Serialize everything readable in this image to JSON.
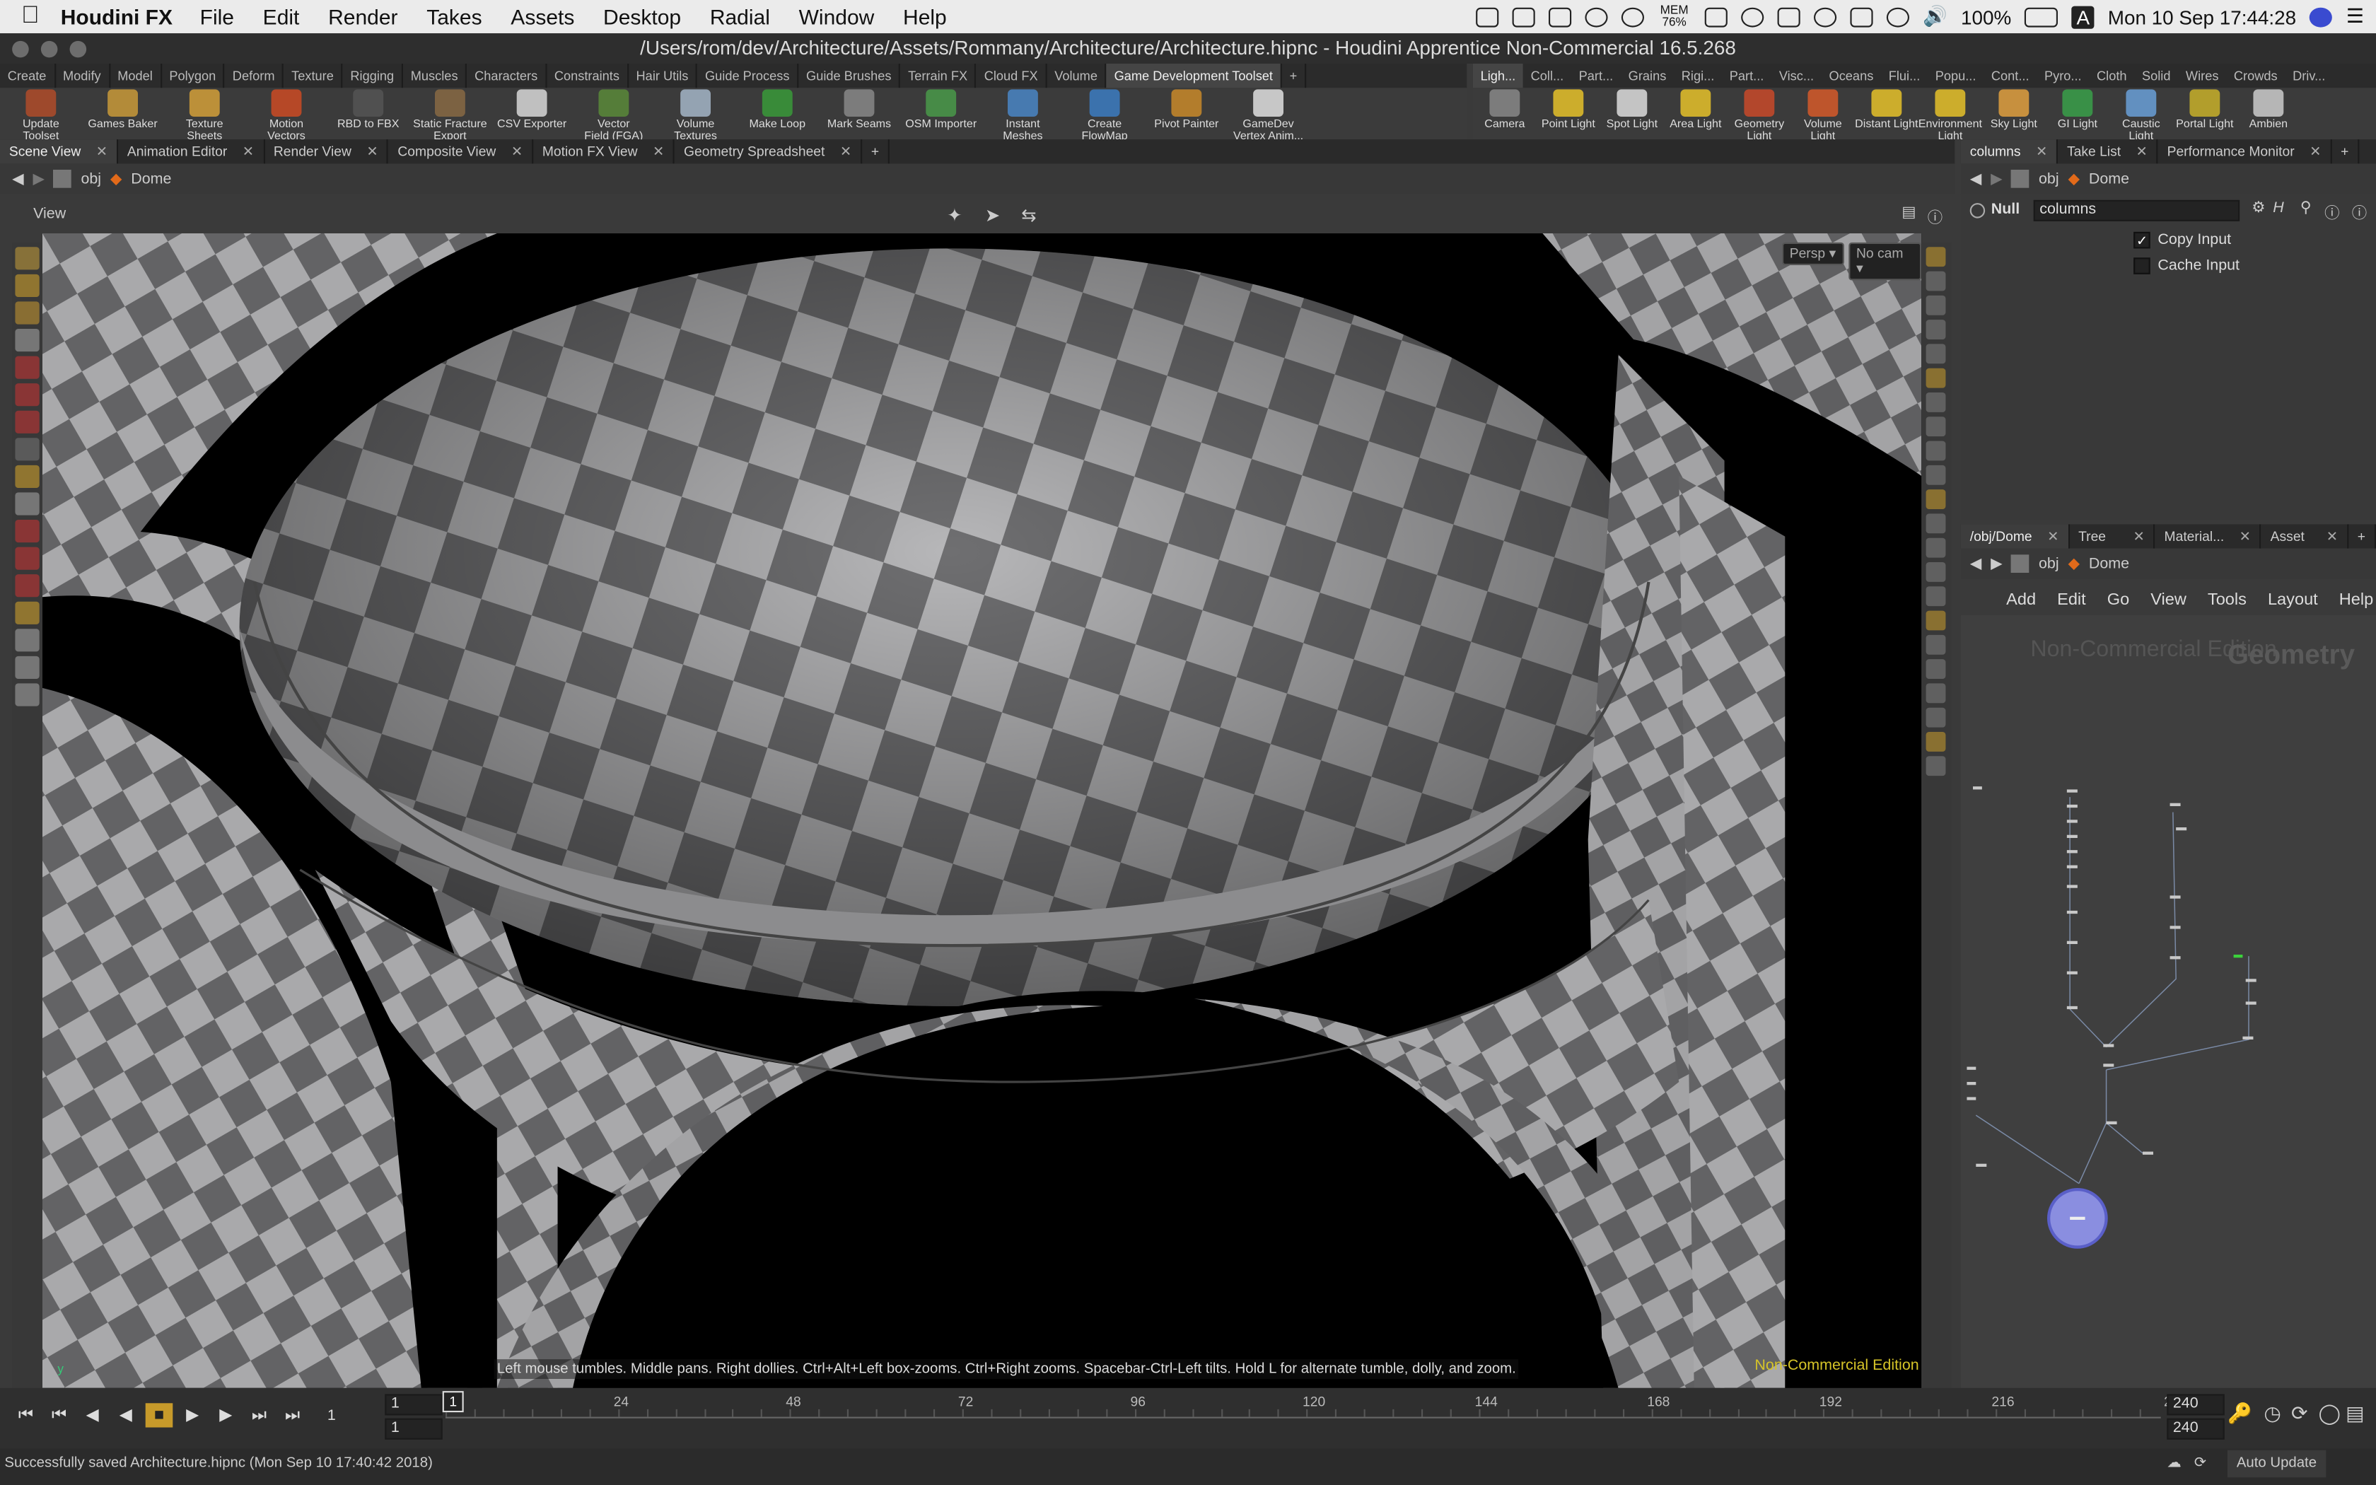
{
  "menubar": {
    "app_name": "Houdini FX",
    "items": [
      "File",
      "Edit",
      "Render",
      "Takes",
      "Assets",
      "Desktop",
      "Radial",
      "Window",
      "Help"
    ],
    "battery_mem": "MEM 76%",
    "battery": "100%",
    "input_source": "A",
    "clock": "Mon 10 Sep  17:44:28"
  },
  "window": {
    "title": "/Users/rom/dev/Architecture/Assets/Rommany/Architecture/Architecture.hipnc - Houdini Apprentice Non-Commercial 16.5.268"
  },
  "shelf_tabs": [
    "Create",
    "Modify",
    "Model",
    "Polygon",
    "Deform",
    "Texture",
    "Rigging",
    "Muscles",
    "Characters",
    "Constraints",
    "Hair Utils",
    "Guide Process",
    "Guide Brushes",
    "Terrain FX",
    "Cloud FX",
    "Volume",
    "Game Development Toolset",
    "+"
  ],
  "light_tabs": [
    "Ligh...",
    "Coll...",
    "Part...",
    "Grains",
    "Rigi...",
    "Part...",
    "Visc...",
    "Oceans",
    "Flui...",
    "Popu...",
    "Cont...",
    "Pyro...",
    "Cloth",
    "Solid",
    "Wires",
    "Crowds",
    "Driv..."
  ],
  "shelf_tools": [
    {
      "label": "Update\nToolset",
      "color": "#b04c2a"
    },
    {
      "label": "Games Baker",
      "color": "#c99a3a"
    },
    {
      "label": "Texture\nSheets",
      "color": "#d4a03a"
    },
    {
      "label": "Motion\nVectors",
      "color": "#cc4b24"
    },
    {
      "label": "RBD to FBX",
      "color": "#555"
    },
    {
      "label": "Static Fracture\nExport",
      "color": "#886a44"
    },
    {
      "label": "CSV Exporter",
      "color": "#d8d8d8"
    },
    {
      "label": "Vector\nField (FGA)",
      "color": "#5b8a3a"
    },
    {
      "label": "Volume\nTextures",
      "color": "#a5b6c8"
    },
    {
      "label": "Make Loop",
      "color": "#3a9a3a"
    },
    {
      "label": "Mark Seams",
      "color": "#888"
    },
    {
      "label": "OSM Importer",
      "color": "#4a9a4a"
    },
    {
      "label": "Instant\nMeshes",
      "color": "#4a86c5"
    },
    {
      "label": "Create\nFlowMap",
      "color": "#3c7cc2"
    },
    {
      "label": "Pivot Painter",
      "color": "#c98a2a"
    },
    {
      "label": "GameDev\nVertex Anim...",
      "color": "#e0e0e0"
    }
  ],
  "light_tools": [
    {
      "label": "Camera",
      "color": "#888"
    },
    {
      "label": "Point Light",
      "color": "#e6c22a"
    },
    {
      "label": "Spot Light",
      "color": "#ddd"
    },
    {
      "label": "Area Light",
      "color": "#e6c22a"
    },
    {
      "label": "Geometry\nLight",
      "color": "#c94a2a"
    },
    {
      "label": "Volume Light",
      "color": "#d65a2a"
    },
    {
      "label": "Distant Light",
      "color": "#e6c22a"
    },
    {
      "label": "Environment\nLight",
      "color": "#e6c22a"
    },
    {
      "label": "Sky Light",
      "color": "#e0a040"
    },
    {
      "label": "GI Light",
      "color": "#3aa04a"
    },
    {
      "label": "Caustic Light",
      "color": "#6aa0d8"
    },
    {
      "label": "Portal Light",
      "color": "#c8b02a"
    },
    {
      "label": "Ambien",
      "color": "#ccc"
    }
  ],
  "pane_tabs": [
    {
      "label": "Scene View",
      "active": true
    },
    {
      "label": "Animation Editor"
    },
    {
      "label": "Render View"
    },
    {
      "label": "Composite View"
    },
    {
      "label": "Motion FX View"
    },
    {
      "label": "Geometry Spreadsheet"
    }
  ],
  "scene_path": {
    "root": "obj",
    "node": "Dome"
  },
  "viewport": {
    "header_label": "View",
    "persp_label": "Persp",
    "cam_label": "No cam",
    "hint": "Left mouse tumbles. Middle pans. Right dollies. Ctrl+Alt+Left box-zooms. Ctrl+Right zooms. Spacebar-Ctrl-Left tilts. Hold L for alternate tumble, dolly, and zoom.",
    "edition": "Non-Commercial Edition"
  },
  "param_tabs": [
    {
      "label": "columns",
      "active": true
    },
    {
      "label": "Take List"
    },
    {
      "label": "Performance Monitor"
    }
  ],
  "param_path": {
    "root": "obj",
    "node": "Dome"
  },
  "params": {
    "node_type": "Null",
    "node_name": "columns",
    "copy_input_label": "Copy Input",
    "copy_input_checked": true,
    "cache_input_label": "Cache Input",
    "cache_input_checked": false
  },
  "net_tabs": [
    {
      "label": "/obj/Dome",
      "active": true
    },
    {
      "label": "Tree View"
    },
    {
      "label": "Material..."
    },
    {
      "label": "Asset Br..."
    }
  ],
  "net_path": {
    "root": "obj",
    "node": "Dome"
  },
  "net_menu": [
    "Add",
    "Edit",
    "Go",
    "View",
    "Tools",
    "Layout",
    "Help"
  ],
  "net_watermark": {
    "left": "Non-Commercial Edition",
    "right": "Geometry"
  },
  "timeline": {
    "start_frame": "1",
    "current_frame": "1",
    "range_start": "1",
    "end_frame": "240",
    "range_end": "240",
    "ticks": [
      "1",
      "24",
      "48",
      "72",
      "96",
      "120",
      "144",
      "168",
      "192",
      "216",
      "2"
    ]
  },
  "status": {
    "message": "Successfully saved Architecture.hipnc (Mon Sep 10 17:40:42 2018)",
    "update_mode": "Auto Update"
  }
}
